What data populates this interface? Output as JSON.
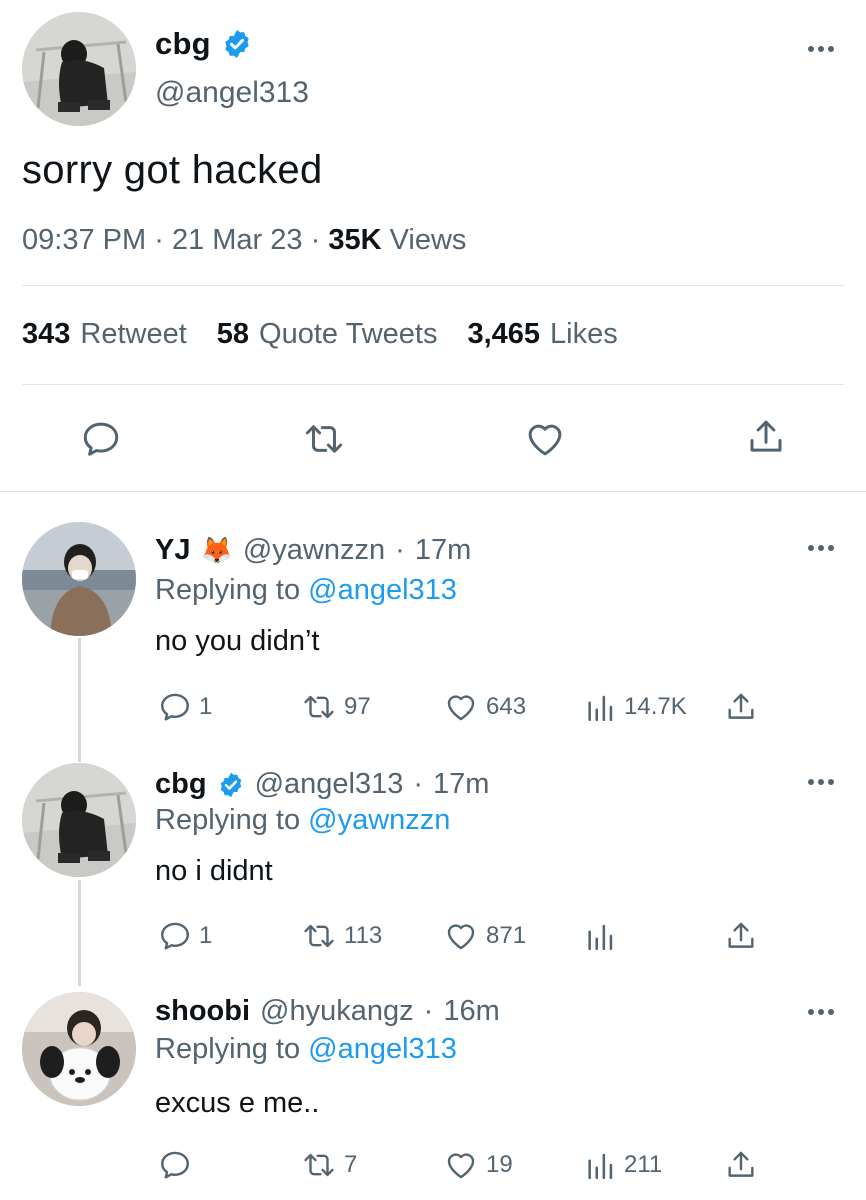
{
  "tweet": {
    "name": "cbg",
    "handle": "@angel313",
    "text": "sorry got hacked",
    "time": "09:37 PM",
    "date": "21 Mar 23",
    "views_count": "35K",
    "views_label": "Views",
    "retweets_count": "343",
    "retweets_label": "Retweet",
    "quotes_count": "58",
    "quotes_label": "Quote Tweets",
    "likes_count": "3,465",
    "likes_label": "Likes"
  },
  "replies": [
    {
      "name": "YJ",
      "emoji": "🦊",
      "handle": "@yawnzzn",
      "time": "17m",
      "replying_label": "Replying to",
      "replying_to": "@angel313",
      "text": "no you didn’t",
      "reply_count": "1",
      "retweet_count": "97",
      "like_count": "643",
      "view_count": "14.7K"
    },
    {
      "name": "cbg",
      "handle": "@angel313",
      "time": "17m",
      "replying_label": "Replying to",
      "replying_to": "@yawnzzn",
      "text": "no i didnt",
      "reply_count": "1",
      "retweet_count": "113",
      "like_count": "871",
      "view_count": ""
    },
    {
      "name": "shoobi",
      "handle": "@hyukangz",
      "time": "16m",
      "replying_label": "Replying to",
      "replying_to": "@angel313",
      "text": "excus e me..",
      "reply_count": "",
      "retweet_count": "7",
      "like_count": "19",
      "view_count": "211"
    }
  ],
  "separator": "·",
  "colors": {
    "accent": "#1d9bf0",
    "secondary_text": "#536471",
    "primary_text": "#0f1419",
    "divider": "#dfe3e6"
  },
  "icons": [
    "verified-badge-icon",
    "more-icon",
    "reply-icon",
    "retweet-icon",
    "like-icon",
    "share-icon",
    "views-icon"
  ]
}
